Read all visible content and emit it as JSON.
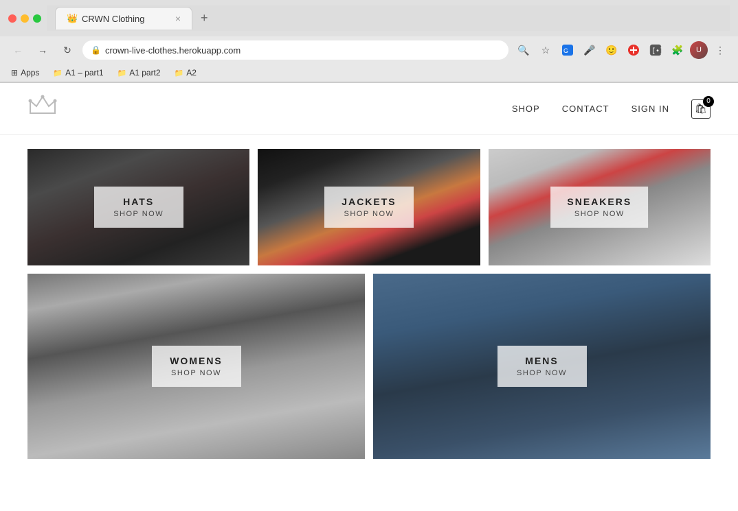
{
  "browser": {
    "traffic_lights": [
      "red",
      "yellow",
      "green"
    ],
    "tab": {
      "favicon": "👑",
      "title": "CRWN Clothing",
      "close": "×"
    },
    "new_tab": "+",
    "nav": {
      "back": "←",
      "forward": "→",
      "reload": "↻"
    },
    "address": "crown-live-clothes.herokuapp.com",
    "lock_icon": "🔒",
    "toolbar_icons": [
      "search",
      "star",
      "translate",
      "mic",
      "face",
      "plus",
      "record",
      "extensions",
      "puzzle",
      "avatar"
    ],
    "more": "⋮"
  },
  "bookmarks": [
    {
      "label": "Apps",
      "icon": "grid"
    },
    {
      "label": "A1 – part1",
      "icon": "folder"
    },
    {
      "label": "A1 part2",
      "icon": "folder"
    },
    {
      "label": "A2",
      "icon": "folder"
    }
  ],
  "site": {
    "nav": {
      "shop": "SHOP",
      "contact": "CONTACT",
      "sign_in": "SIGN IN"
    },
    "cart_count": "0",
    "products": [
      {
        "id": "hats",
        "name": "HATS",
        "shop_now": "SHOP NOW",
        "row": "top"
      },
      {
        "id": "jackets",
        "name": "JACKETS",
        "shop_now": "SHOP NOW",
        "row": "top"
      },
      {
        "id": "sneakers",
        "name": "SNEAKERS",
        "shop_now": "SHOP NOW",
        "row": "top"
      },
      {
        "id": "womens",
        "name": "WOMENS",
        "shop_now": "SHOP NOW",
        "row": "bottom"
      },
      {
        "id": "mens",
        "name": "MENS",
        "shop_now": "SHOP NOW",
        "row": "bottom"
      }
    ]
  }
}
